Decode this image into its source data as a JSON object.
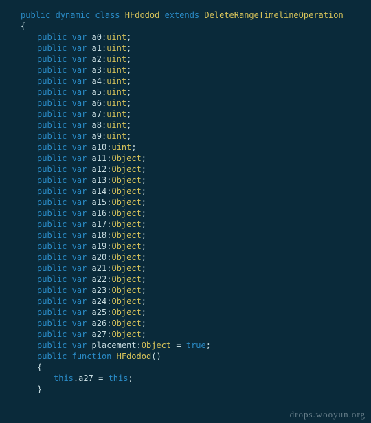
{
  "kw": {
    "public": "public",
    "dynamic": "dynamic",
    "class": "class",
    "extends": "extends",
    "var": "var",
    "function": "function",
    "this": "this",
    "true": "true"
  },
  "header": {
    "className": "HFdodod",
    "baseClass": "DeleteRangeTimelineOperation"
  },
  "uintVars": [
    "a0",
    "a1",
    "a2",
    "a3",
    "a4",
    "a5",
    "a6",
    "a7",
    "a8",
    "a9",
    "a10"
  ],
  "uintType": "uint",
  "objVars": [
    "a11",
    "a12",
    "a13",
    "a14",
    "a15",
    "a16",
    "a17",
    "a18",
    "a19",
    "a20",
    "a21",
    "a22",
    "a23",
    "a24",
    "a25",
    "a26",
    "a27"
  ],
  "objType": "Object",
  "placement": {
    "name": "placement",
    "type": "Object",
    "value": "true"
  },
  "ctor": {
    "name": "HFdodod",
    "bodyLhsObj": "this",
    "bodyLhsProp": "a27",
    "bodyRhs": "this"
  },
  "watermark": "drops.wooyun.org"
}
